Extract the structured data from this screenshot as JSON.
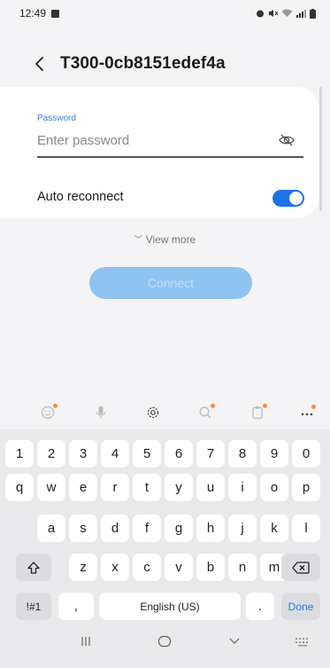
{
  "status": {
    "time": "12:49"
  },
  "header": {
    "title": "T300-0cb8151edef4a"
  },
  "password": {
    "label": "Password",
    "placeholder": "Enter password",
    "value": ""
  },
  "auto_reconnect": {
    "label": "Auto reconnect",
    "enabled": true
  },
  "view_more": "View more",
  "connect_label": "Connect",
  "keyboard": {
    "row1": [
      "1",
      "2",
      "3",
      "4",
      "5",
      "6",
      "7",
      "8",
      "9",
      "0"
    ],
    "row2": [
      "q",
      "w",
      "e",
      "r",
      "t",
      "y",
      "u",
      "i",
      "o",
      "p"
    ],
    "row3": [
      "a",
      "s",
      "d",
      "f",
      "g",
      "h",
      "j",
      "k",
      "l"
    ],
    "row4": [
      "z",
      "x",
      "c",
      "v",
      "b",
      "n",
      "m"
    ],
    "symbols_label": "!#1",
    "comma": ",",
    "space_label": "English (US)",
    "period": ".",
    "done_label": "Done"
  },
  "colors": {
    "accent": "#1e73e8",
    "connect_disabled": "#8fc3f0",
    "label_blue": "#3a7bd5"
  }
}
